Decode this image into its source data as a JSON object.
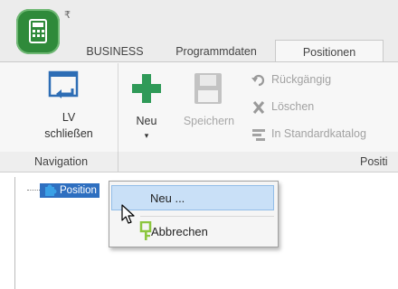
{
  "quick_access": {
    "dropdown_glyph": "₹"
  },
  "tabs": [
    {
      "label": "BUSINESS"
    },
    {
      "label": "Programmdaten"
    },
    {
      "label": "Positionen",
      "active": true
    }
  ],
  "ribbon": {
    "lv_close_label_line1": "LV",
    "lv_close_label_line2": "schließen",
    "new_label": "Neu",
    "new_dropdown_glyph": "▾",
    "save_label": "Speichern",
    "undo_label": "Rückgängig",
    "delete_label": "Löschen",
    "standard_catalog_label": "In Standardkatalog",
    "group_navigation": "Navigation",
    "group_positions": "Positi"
  },
  "tree": {
    "root_label": "Position"
  },
  "context_menu": {
    "items": [
      {
        "label": "Neu ...",
        "highlighted": true
      },
      {
        "label": "Abbrechen"
      }
    ]
  },
  "colors": {
    "accent_green": "#2f8a3a",
    "selection_blue": "#2e6fc0",
    "menu_highlight": "#c9e0f7"
  }
}
